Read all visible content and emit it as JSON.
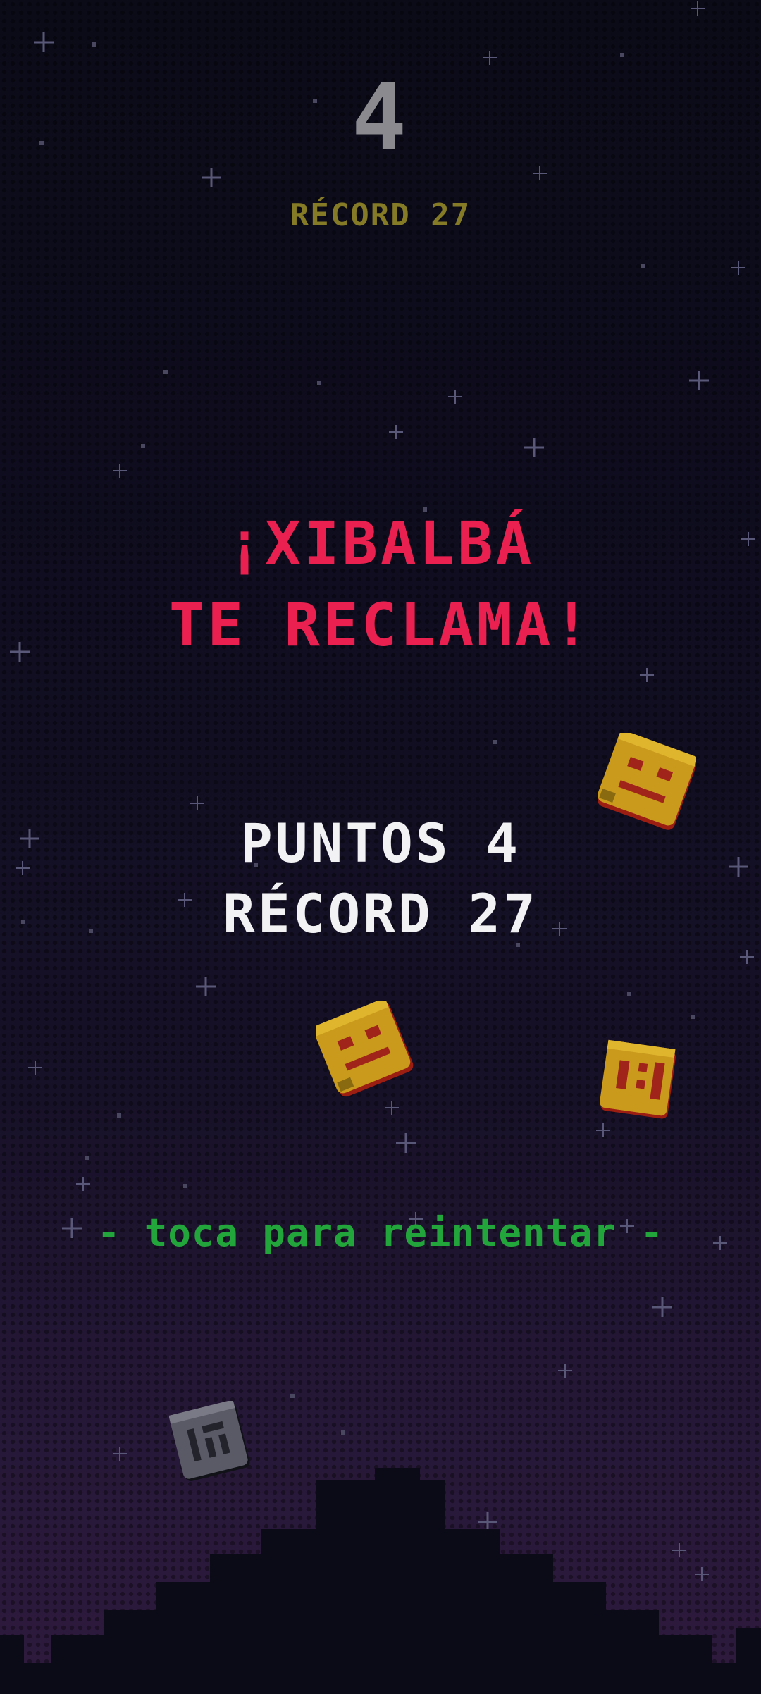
{
  "hud": {
    "score": "4",
    "record_label": "RÉCORD 27"
  },
  "game_over": {
    "title_line1": "¡XIBALBÁ",
    "title_line2": "TE RECLAMA!",
    "points_line": "PUNTOS 4",
    "record_line": "RÉCORD 27",
    "retry_prompt": "- toca para reintentar -"
  },
  "colors": {
    "background_top": "#0b0b18",
    "background_bottom": "#2e1a3e",
    "score": "#8a8a8f",
    "record_hud": "#857a26",
    "title": "#ea2150",
    "stats": "#f2f2f4",
    "retry": "#22a53a",
    "gold_mask": "#c99a1c",
    "stone_mask": "#5a5a66",
    "hills": "#0b0b17"
  },
  "sprites": [
    {
      "kind": "gold-mask-icon"
    },
    {
      "kind": "gold-mask-icon"
    },
    {
      "kind": "gold-mask-icon"
    },
    {
      "kind": "stone-mask-icon"
    }
  ]
}
